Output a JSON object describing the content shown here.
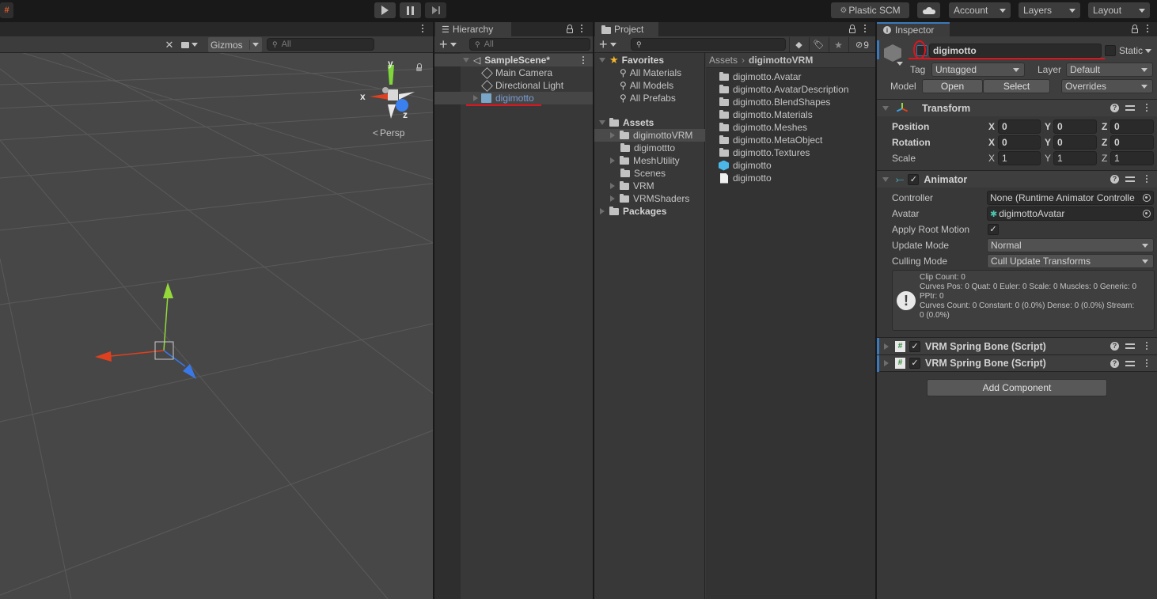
{
  "toolbar": {
    "play_icon": "play-icon",
    "pause_icon": "pause-icon",
    "step_icon": "step-icon",
    "plastic_scm": "Plastic SCM",
    "cloud_icon": "cloud-icon",
    "account": "Account",
    "layers": "Layers",
    "layout": "Layout"
  },
  "scene": {
    "gizmos_label": "Gizmos",
    "search_placeholder": "All",
    "axis_x": "x",
    "axis_y": "y",
    "axis_z": "z",
    "projection": "Persp",
    "colors": {
      "x_axis": "#e0401e",
      "y_axis": "#94d83a",
      "z_axis": "#3a78e8",
      "background": "#474747"
    }
  },
  "hierarchy": {
    "tab": "Hierarchy",
    "search_placeholder": "All",
    "scene_name": "SampleScene*",
    "items": [
      {
        "label": "Main Camera",
        "selected": false
      },
      {
        "label": "Directional Light",
        "selected": false
      },
      {
        "label": "digimotto",
        "selected": true,
        "prefab": true
      }
    ]
  },
  "project": {
    "tab": "Project",
    "search_placeholder": "",
    "hidden_count": "9",
    "favorites": {
      "label": "Favorites",
      "items": [
        "All Materials",
        "All Models",
        "All Prefabs"
      ]
    },
    "assets": {
      "label": "Assets",
      "items": [
        {
          "label": "digimottoVRM",
          "expandable": true,
          "selected": true
        },
        {
          "label": "digimottto",
          "expandable": false,
          "selected": false
        },
        {
          "label": "MeshUtility",
          "expandable": true,
          "selected": false
        },
        {
          "label": "Scenes",
          "expandable": false,
          "selected": false
        },
        {
          "label": "VRM",
          "expandable": true,
          "selected": false
        },
        {
          "label": "VRMShaders",
          "expandable": true,
          "selected": false
        }
      ]
    },
    "packages_label": "Packages",
    "breadcrumb": [
      "Assets",
      "digimottoVRM"
    ],
    "files": [
      {
        "label": "digimotto.Avatar",
        "type": "folder"
      },
      {
        "label": "digimotto.AvatarDescription",
        "type": "folder"
      },
      {
        "label": "digimotto.BlendShapes",
        "type": "folder"
      },
      {
        "label": "digimotto.Materials",
        "type": "folder"
      },
      {
        "label": "digimotto.Meshes",
        "type": "folder"
      },
      {
        "label": "digimotto.MetaObject",
        "type": "folder"
      },
      {
        "label": "digimotto.Textures",
        "type": "folder"
      },
      {
        "label": "digimotto",
        "type": "prefab"
      },
      {
        "label": "digimotto",
        "type": "file"
      }
    ]
  },
  "inspector": {
    "tab": "Inspector",
    "object_name": "digimotto",
    "active": false,
    "static_label": "Static",
    "tag_label": "Tag",
    "tag_value": "Untagged",
    "layer_label": "Layer",
    "layer_value": "Default",
    "model_label": "Model",
    "open_label": "Open",
    "select_label": "Select",
    "overrides_label": "Overrides",
    "transform": {
      "title": "Transform",
      "rows": [
        {
          "label": "Position",
          "x": "0",
          "y": "0",
          "z": "0"
        },
        {
          "label": "Rotation",
          "x": "0",
          "y": "0",
          "z": "0"
        },
        {
          "label": "Scale",
          "x": "1",
          "y": "1",
          "z": "1"
        }
      ]
    },
    "animator": {
      "title": "Animator",
      "enabled": true,
      "controller_label": "Controller",
      "controller_value": "None (Runtime Animator Controlle",
      "avatar_label": "Avatar",
      "avatar_value": "digimottoAvatar",
      "apply_root_motion_label": "Apply Root Motion",
      "apply_root_motion": true,
      "update_mode_label": "Update Mode",
      "update_mode_value": "Normal",
      "culling_mode_label": "Culling Mode",
      "culling_mode_value": "Cull Update Transforms",
      "info_lines": [
        "Clip Count: 0",
        "Curves Pos: 0 Quat: 0 Euler: 0 Scale: 0 Muscles: 0 Generic: 0",
        "PPtr: 0",
        "Curves Count: 0 Constant: 0 (0.0%) Dense: 0 (0.0%) Stream:",
        "0 (0.0%)"
      ]
    },
    "spring_bones": [
      {
        "title": "VRM Spring Bone (Script)",
        "enabled": true
      },
      {
        "title": "VRM Spring Bone (Script)",
        "enabled": true
      }
    ],
    "add_component": "Add Component",
    "axis_labels": {
      "x": "X",
      "y": "Y",
      "z": "Z"
    }
  }
}
